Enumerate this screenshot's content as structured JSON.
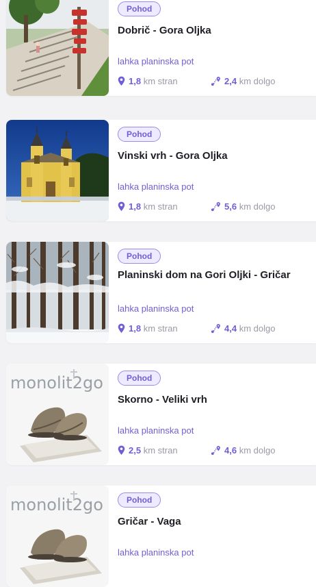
{
  "trails": [
    {
      "badge": "Pohod",
      "title": "Dobrič - Gora Oljka",
      "difficulty": "lahka planinska pot",
      "distance_value": "1,8",
      "distance_label": "km stran",
      "length_value": "2,4",
      "length_label": "km dolgo",
      "thumb": "stairs-signpost-photo"
    },
    {
      "badge": "Pohod",
      "title": "Vinski vrh - Gora Oljka",
      "difficulty": "lahka planinska pot",
      "distance_value": "1,8",
      "distance_label": "km stran",
      "length_value": "5,6",
      "length_label": "km dolgo",
      "thumb": "church-photo"
    },
    {
      "badge": "Pohod",
      "title": "Planinski dom na Gori Oljki - Gričar",
      "difficulty": "lahka planinska pot",
      "distance_value": "1,8",
      "distance_label": "km stran",
      "length_value": "4,4",
      "length_label": "km dolgo",
      "thumb": "snowy-forest-photo"
    },
    {
      "badge": "Pohod",
      "title": "Skorno - Veliki vrh",
      "difficulty": "lahka planinska pot",
      "distance_value": "2,5",
      "distance_label": "km stran",
      "length_value": "4,6",
      "length_label": "km dolgo",
      "thumb": "monolit2go-boots-placeholder",
      "thumb_logo": "monolit2go"
    },
    {
      "badge": "Pohod",
      "title": "Gričar - Vaga",
      "difficulty": "lahka planinska pot",
      "thumb": "monolit2go-boots-placeholder",
      "thumb_logo": "monolit2go"
    }
  ],
  "colors": {
    "accent": "#6f5fd6",
    "badge_bg": "#eeeaff",
    "badge_border": "#9b8be8",
    "title": "#1e1e24",
    "muted": "#9a9aa4",
    "page_bg": "#f2f2f4"
  },
  "icons": {
    "distance": "map-pin-icon",
    "length": "route-icon"
  }
}
